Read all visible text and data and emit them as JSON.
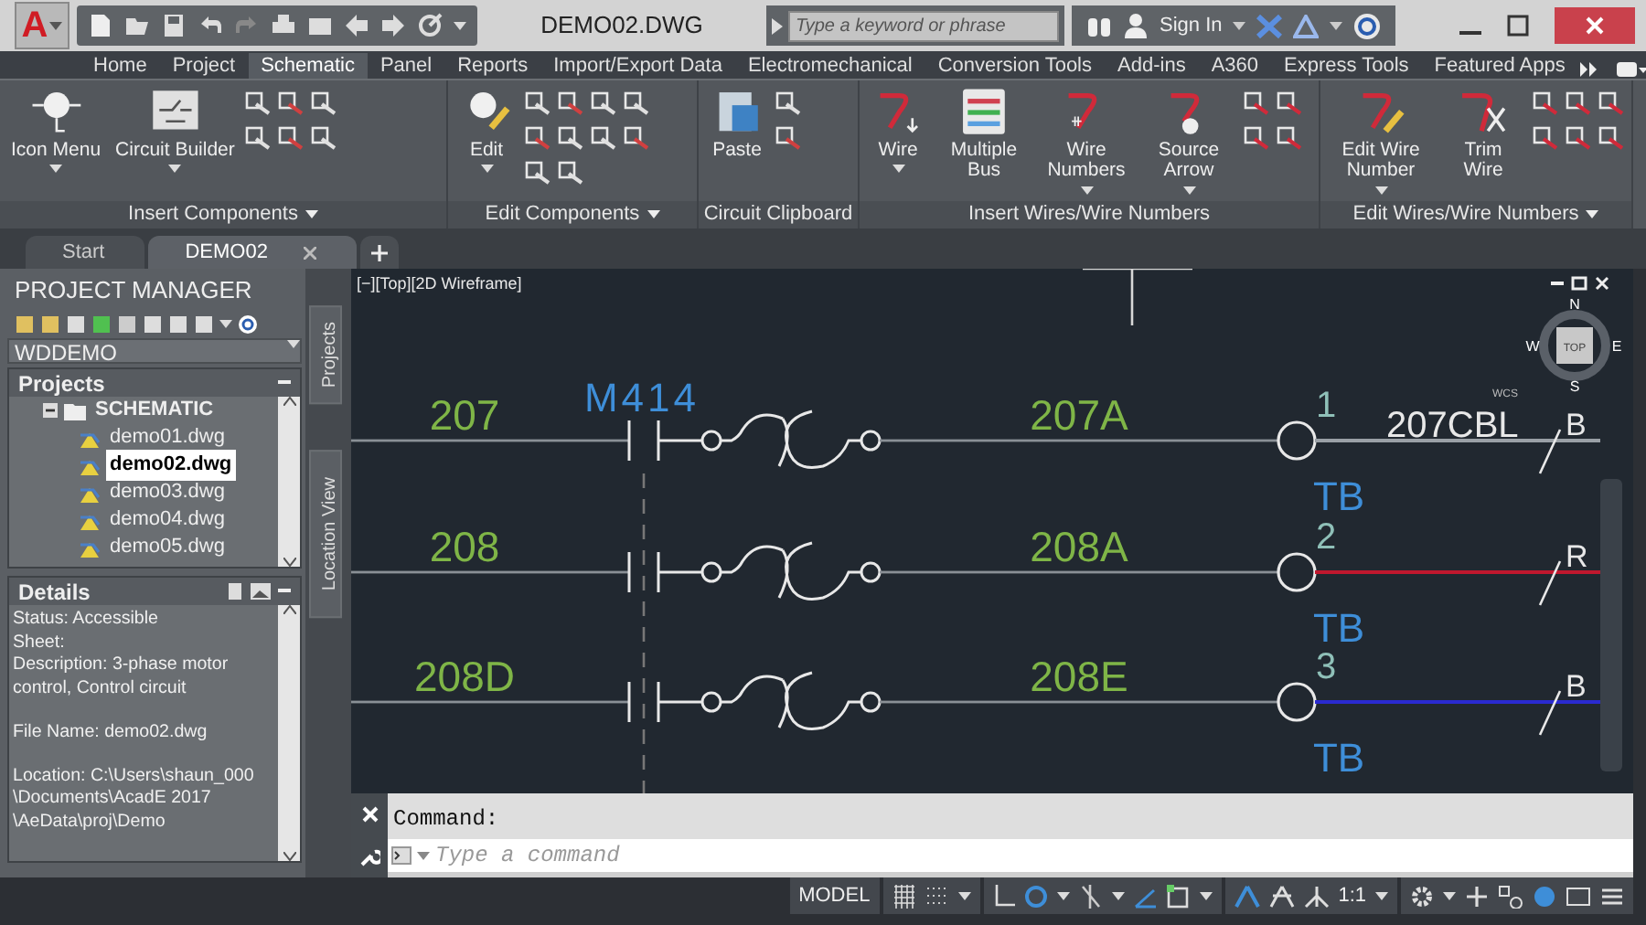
{
  "title_bar": {
    "app_letter": "A",
    "file_name": "DEMO02.DWG",
    "search": {
      "placeholder": "Type a keyword or phrase"
    },
    "sign_in": "Sign In"
  },
  "ribbon_tabs": [
    {
      "label": "Home",
      "selected": false
    },
    {
      "label": "Project",
      "selected": false
    },
    {
      "label": "Schematic",
      "selected": true
    },
    {
      "label": "Panel",
      "selected": false
    },
    {
      "label": "Reports",
      "selected": false
    },
    {
      "label": "Import/Export Data",
      "selected": false
    },
    {
      "label": "Electromechanical",
      "selected": false
    },
    {
      "label": "Conversion Tools",
      "selected": false
    },
    {
      "label": "Add-ins",
      "selected": false
    },
    {
      "label": "A360",
      "selected": false
    },
    {
      "label": "Express Tools",
      "selected": false
    },
    {
      "label": "Featured Apps",
      "selected": false
    }
  ],
  "ribbon_panels": [
    {
      "title": "Insert Components",
      "has_menu": true,
      "buttons": [
        {
          "label": "Icon Menu",
          "has_menu": true
        },
        {
          "label": "Circuit Builder",
          "has_menu": true
        }
      ]
    },
    {
      "title": "Edit Components",
      "has_menu": true,
      "buttons": [
        {
          "label": "Edit",
          "has_menu": true
        }
      ]
    },
    {
      "title": "Circuit Clipboard",
      "has_menu": false,
      "buttons": [
        {
          "label": "Paste",
          "has_menu": false
        }
      ]
    },
    {
      "title": "Insert Wires/Wire Numbers",
      "has_menu": false,
      "buttons": [
        {
          "label": "Wire",
          "has_menu": true
        },
        {
          "label": "Multiple Bus",
          "has_menu": false
        },
        {
          "label": "Wire Numbers",
          "has_menu": true
        },
        {
          "label": "Source Arrow",
          "has_menu": true
        }
      ]
    },
    {
      "title": "Edit Wires/Wire Numbers",
      "has_menu": true,
      "buttons": [
        {
          "label": "Edit Wire Number",
          "has_menu": true
        },
        {
          "label": "Trim Wire",
          "has_menu": false
        }
      ]
    }
  ],
  "document_tabs": [
    {
      "label": "Start",
      "selected": false
    },
    {
      "label": "DEMO02",
      "selected": true
    }
  ],
  "project_manager": {
    "title": "PROJECT MANAGER",
    "project": "WDDEMO",
    "projects_header": "Projects",
    "tree": [
      {
        "label": "SCHEMATIC",
        "expanded": true,
        "children": [
          {
            "label": "demo01.dwg",
            "selected": false
          },
          {
            "label": "demo02.dwg",
            "selected": true
          },
          {
            "label": "demo03.dwg",
            "selected": false
          },
          {
            "label": "demo04.dwg",
            "selected": false
          },
          {
            "label": "demo05.dwg",
            "selected": false
          }
        ]
      }
    ],
    "details_header": "Details",
    "details": [
      [
        "Status: Accessible",
        "Sheet:",
        "Description: 3-phase motor control, Control circuit"
      ],
      [
        "File Name: demo02.dwg"
      ],
      [
        "Location: C:\\Users\\shaun_000",
        "\\Documents\\AcadE 2017",
        "\\AeData\\proj\\Demo"
      ]
    ]
  },
  "side_tabs": [
    "Projects",
    "Location View"
  ],
  "viewport": {
    "label": "[−][Top][2D Wireframe]",
    "compass": {
      "north": "N",
      "south": "S",
      "east": "E",
      "west": "W",
      "center": "TOP",
      "ucs": "WCS"
    },
    "rungs": [
      {
        "wire_number": "207",
        "device_tag": "M414",
        "wire_id": "207A",
        "terminal_number": "1",
        "terminal_tag": "TB",
        "cable_label": "207CBL",
        "wire_label": "B",
        "color": "#9aa0a6"
      },
      {
        "wire_number": "208",
        "wire_id": "208A",
        "terminal_number": "2",
        "terminal_tag": "TB",
        "wire_label": "R",
        "color": "#c0182e"
      },
      {
        "wire_number": "208D",
        "wire_id": "208E",
        "terminal_number": "3",
        "terminal_tag": "TB",
        "wire_label": "B",
        "color": "#2a2ad0"
      }
    ]
  },
  "command": {
    "history": "Command:",
    "placeholder": "Type a command"
  },
  "status_bar": {
    "model": "MODEL",
    "scale": "1:1"
  }
}
